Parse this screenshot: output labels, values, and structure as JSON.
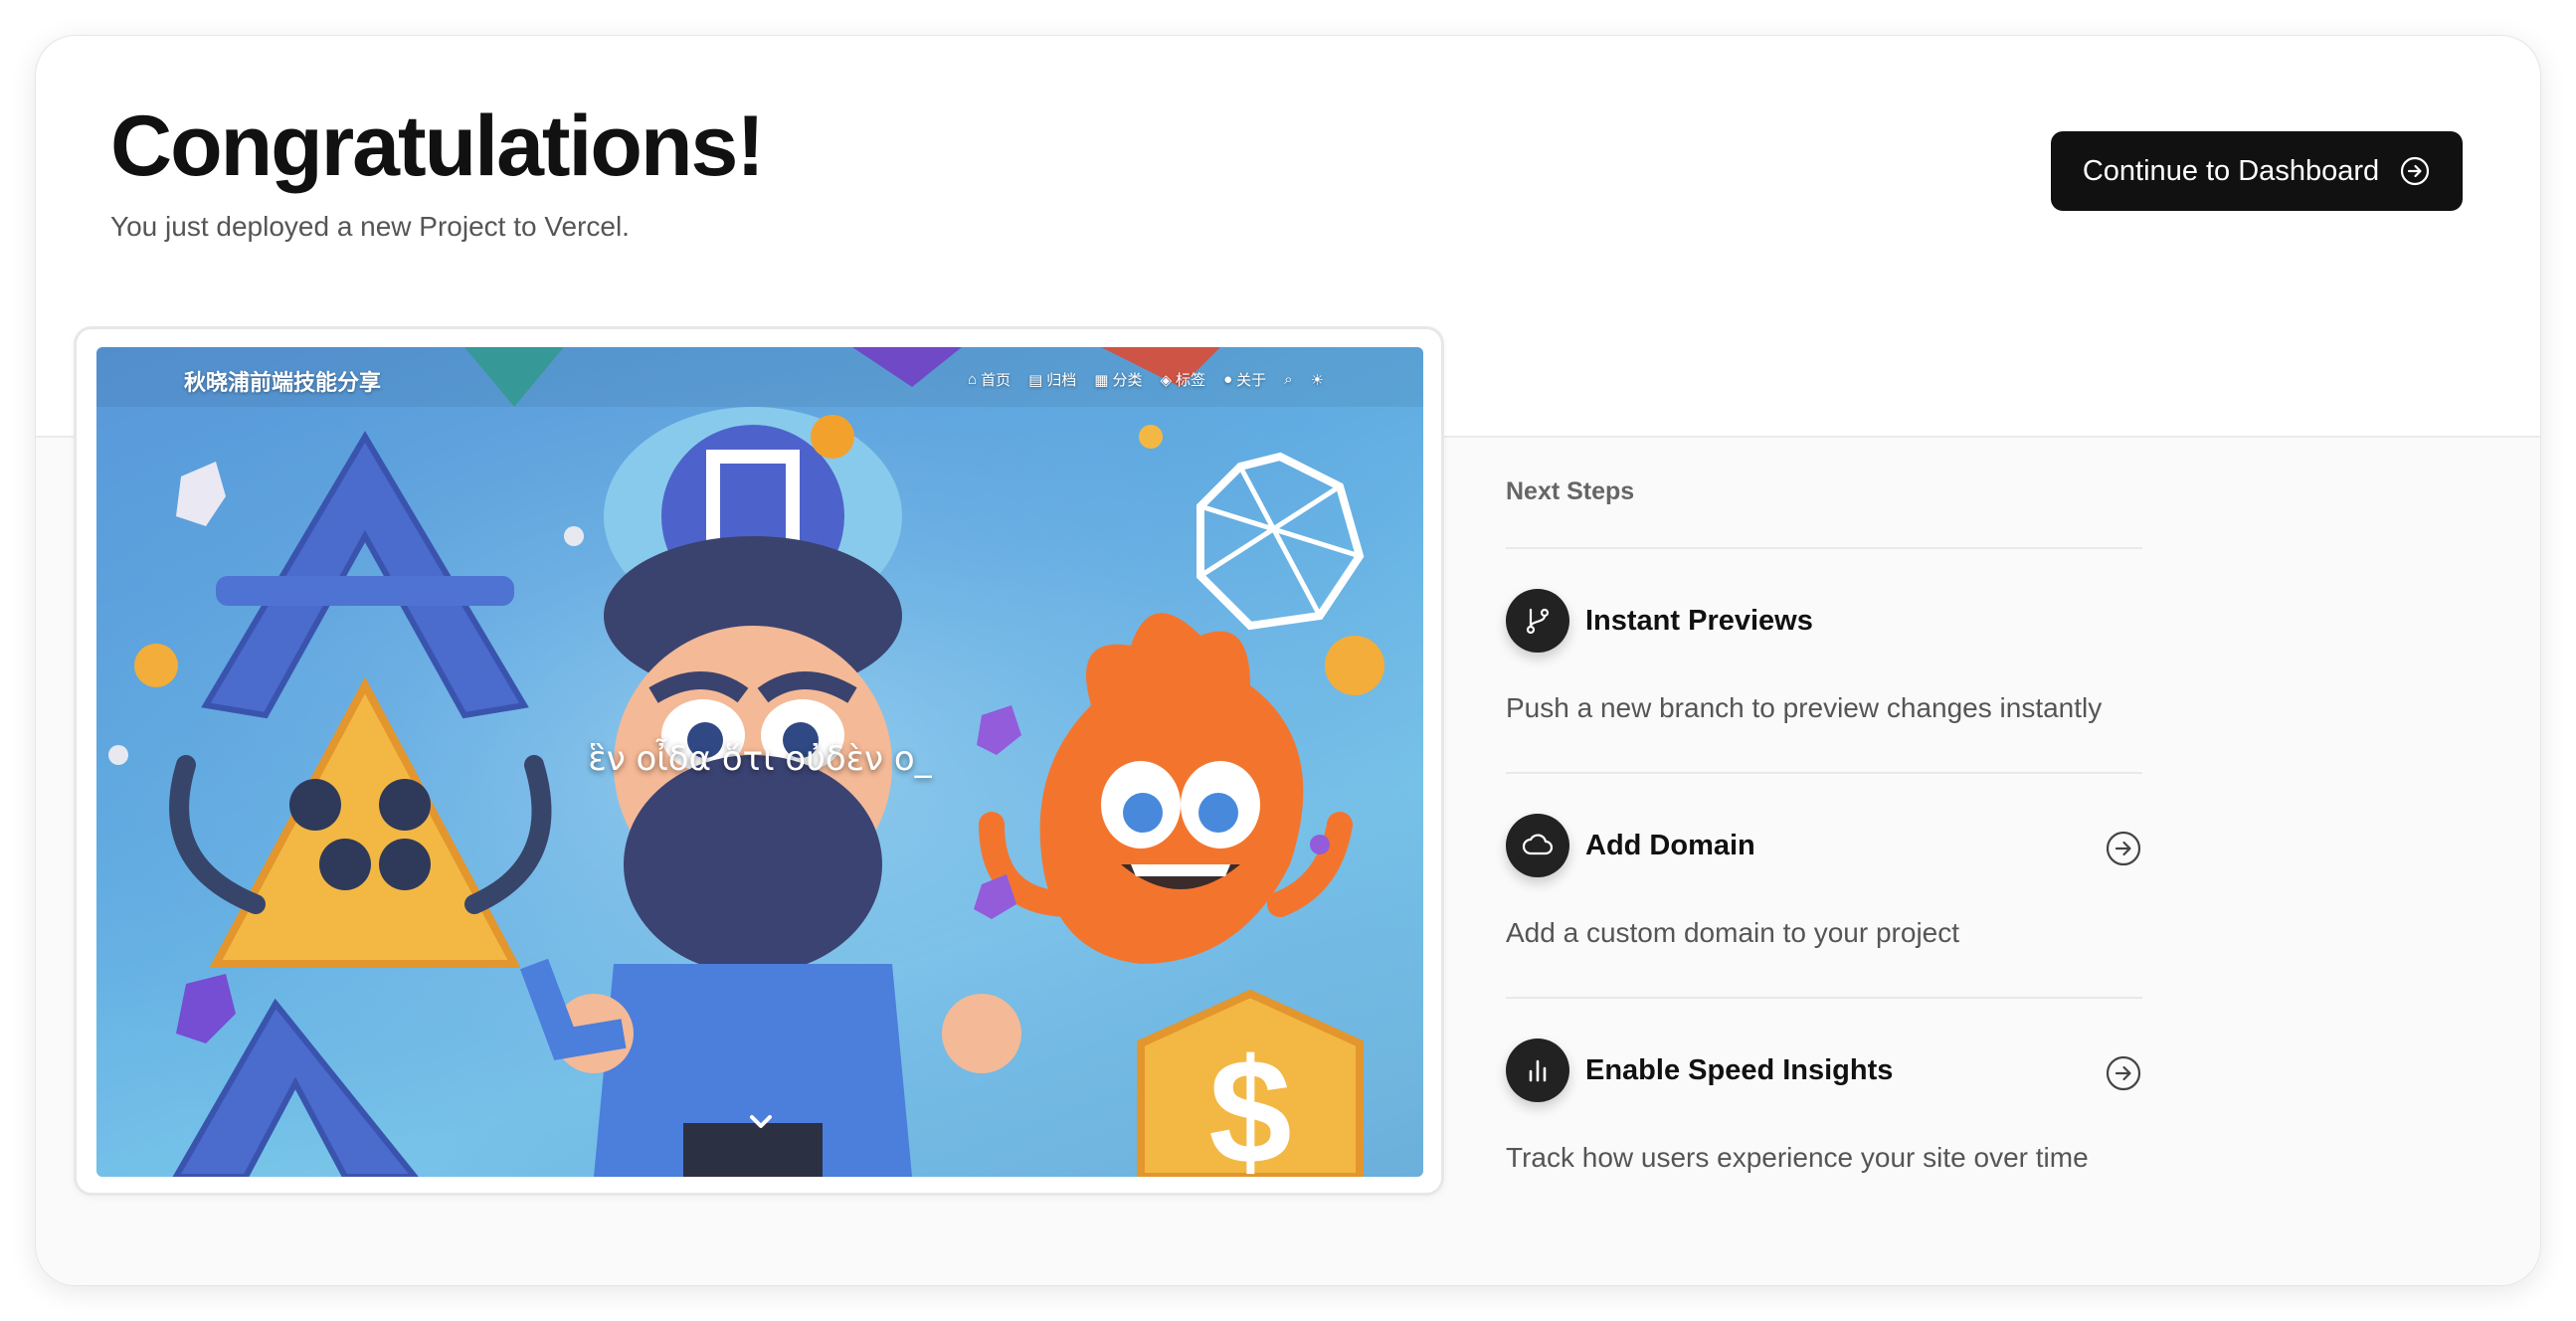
{
  "header": {
    "title": "Congratulations!",
    "subtitle": "You just deployed a new Project to Vercel.",
    "cta_label": "Continue to Dashboard",
    "cta_icon": "arrow-right-circle-icon"
  },
  "preview": {
    "site_name": "秋晓浦前端技能分享",
    "nav": [
      {
        "icon": "home-icon",
        "label": "首页"
      },
      {
        "icon": "archive-icon",
        "label": "归档"
      },
      {
        "icon": "grid-icon",
        "label": "分类"
      },
      {
        "icon": "tag-icon",
        "label": "标签"
      },
      {
        "icon": "user-icon",
        "label": "关于"
      }
    ],
    "extra_icons": [
      "search-icon",
      "sun-icon"
    ],
    "hero_text": "ἓν οἶδα ὅτι οὐδὲν ο_"
  },
  "next_steps": {
    "label": "Next Steps",
    "items": [
      {
        "icon": "git-branch-icon",
        "title": "Instant Previews",
        "description": "Push a new branch to preview changes instantly",
        "has_link": false
      },
      {
        "icon": "cloud-icon",
        "title": "Add Domain",
        "description": "Add a custom domain to your project",
        "has_link": true
      },
      {
        "icon": "bar-chart-icon",
        "title": "Enable Speed Insights",
        "description": "Track how users experience your site over time",
        "has_link": true
      }
    ]
  },
  "colors": {
    "primary_button": "#111111",
    "badge": "#222222",
    "muted_text": "#555555"
  }
}
